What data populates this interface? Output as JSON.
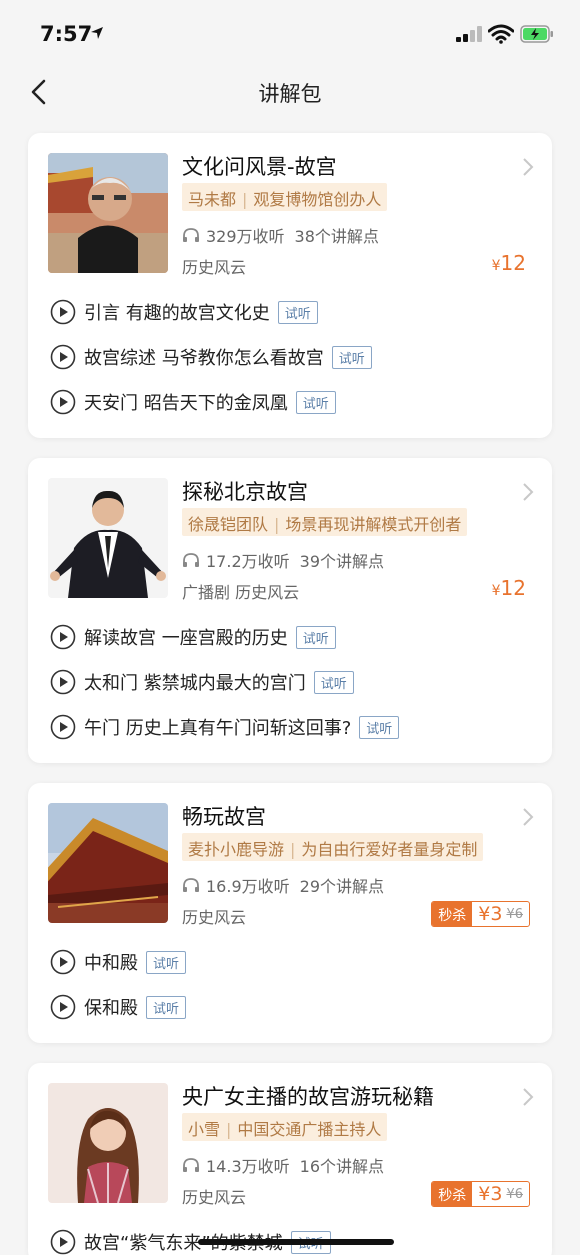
{
  "status": {
    "time": "7:57"
  },
  "nav": {
    "title": "讲解包"
  },
  "cards": [
    {
      "title": "文化问风景-故宫",
      "author": "马未都",
      "author_desc": "观复博物馆创办人",
      "plays": "329万收听",
      "points": "38个讲解点",
      "category": "历史风云",
      "price": "12",
      "lessons": [
        {
          "title": "引言  有趣的故宫文化史",
          "trial": "试听"
        },
        {
          "title": "故宫综述  马爷教你怎么看故宫",
          "trial": "试听"
        },
        {
          "title": "天安门  昭告天下的金凤凰",
          "trial": "试听"
        }
      ]
    },
    {
      "title": "探秘北京故宫",
      "author": "徐晟铠团队",
      "author_desc": "场景再现讲解模式开创者",
      "plays": "17.2万收听",
      "points": "39个讲解点",
      "category": "广播剧 历史风云",
      "price": "12",
      "lessons": [
        {
          "title": "解读故宫  一座宫殿的历史",
          "trial": "试听"
        },
        {
          "title": "太和门  紫禁城内最大的宫门",
          "trial": "试听"
        },
        {
          "title": "午门  历史上真有午门问斩这回事?",
          "trial": "试听"
        }
      ]
    },
    {
      "title": "畅玩故宫",
      "author": "麦扑小鹿导游",
      "author_desc": "为自由行爱好者量身定制",
      "plays": "16.9万收听",
      "points": "29个讲解点",
      "category": "历史风云",
      "flash_label": "秒杀",
      "price": "3",
      "old_price": "¥6",
      "lessons": [
        {
          "title": "中和殿",
          "trial": "试听"
        },
        {
          "title": "保和殿",
          "trial": "试听"
        }
      ]
    },
    {
      "title": "央广女主播的故宫游玩秘籍",
      "author": "小雪",
      "author_desc": "中国交通广播主持人",
      "plays": "14.3万收听",
      "points": "16个讲解点",
      "category": "历史风云",
      "flash_label": "秒杀",
      "price": "3",
      "old_price": "¥6",
      "lessons": [
        {
          "title": "故宫“紫气东来”的紫禁城",
          "trial": "试听"
        }
      ]
    }
  ],
  "currency": "¥",
  "colors": {
    "accent": "#e8732e",
    "tag_bg": "#fbeede",
    "tag_text": "#b07a45",
    "trial": "#5b7fa8"
  }
}
